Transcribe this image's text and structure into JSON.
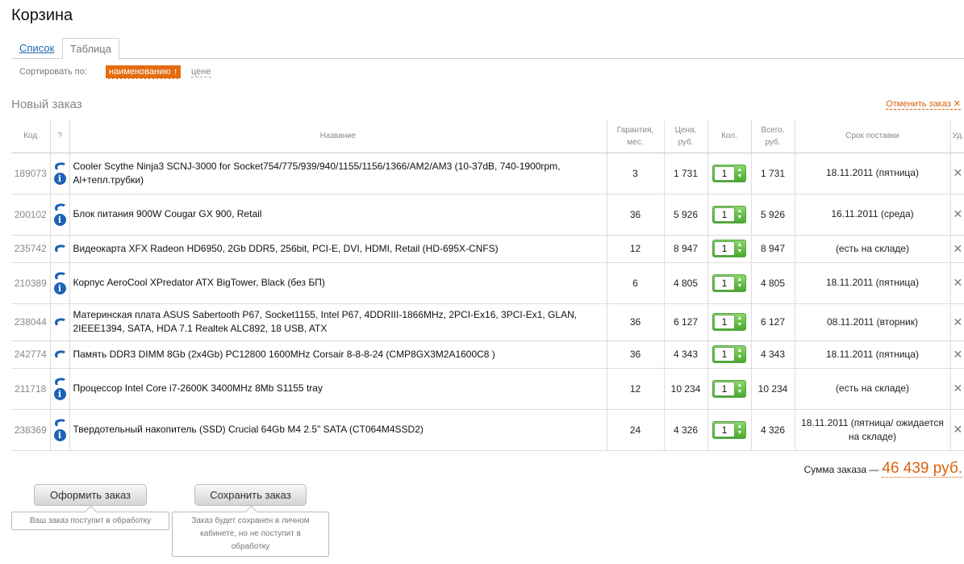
{
  "page": {
    "title": "Корзина"
  },
  "tabs": {
    "list": "Список",
    "table": "Таблица"
  },
  "sort": {
    "label": "Сортировать по:",
    "by_name": "наименованию ↑",
    "by_price": "цене"
  },
  "order": {
    "title": "Новый заказ",
    "cancel": "Отменить заказ"
  },
  "table": {
    "headers": {
      "code": "Код",
      "help": "?",
      "name": "Название",
      "warranty": [
        "Гарантия,",
        "мес."
      ],
      "price": [
        "Цена,",
        "руб."
      ],
      "qty": "Кол.",
      "total": [
        "Всего,",
        "руб."
      ],
      "term": "Срок поставки",
      "del": "Уд."
    },
    "rows": [
      {
        "code": "189073",
        "name": "Cooler Scythe Ninja3 SCNJ-3000 for Socket754/775/939/940/1155/1156/1366/AM2/AM3 (10-37dB, 740-1900rpm, Al+тепл.трубки)",
        "warranty": "3",
        "price": "1 731",
        "qty": "1",
        "total": "1 731",
        "term": "18.11.2011 (пятница)",
        "info": true,
        "height": 51
      },
      {
        "code": "200102",
        "name": "Блок питания 900W Cougar GX 900, Retail",
        "warranty": "36",
        "price": "5 926",
        "qty": "1",
        "total": "5 926",
        "term": "16.11.2011 (среда)",
        "info": true,
        "height": 51
      },
      {
        "code": "235742",
        "name": "Видеокарта XFX Radeon HD6950, 2Gb DDR5, 256bit, PCI-E, DVI, HDMI, Retail (HD-695X-CNFS)",
        "warranty": "12",
        "price": "8 947",
        "qty": "1",
        "total": "8 947",
        "term": "(есть на складе)",
        "info": false,
        "height": 34
      },
      {
        "code": "210389",
        "name": "Корпус AeroCool XPredator ATX BigTower, Black (без БП)",
        "warranty": "6",
        "price": "4 805",
        "qty": "1",
        "total": "4 805",
        "term": "18.11.2011 (пятница)",
        "info": true,
        "height": 51
      },
      {
        "code": "238044",
        "name": "Материнская плата ASUS Sabertooth P67, Socket1155, Intel P67, 4DDRIII-1866MHz, 2PCI-Ex16, 3PCI-Ex1, GLAN, 2IEEE1394, SATA, HDA 7.1 Realtek ALC892, 18 USB, ATX",
        "warranty": "36",
        "price": "6 127",
        "qty": "1",
        "total": "6 127",
        "term": "08.11.2011 (вторник)",
        "info": false,
        "height": 46
      },
      {
        "code": "242774",
        "name": "Память DDR3 DIMM 8Gb (2x4Gb) PC12800 1600MHz Corsair 8-8-8-24 (CMP8GX3M2A1600C8 )",
        "warranty": "36",
        "price": "4 343",
        "qty": "1",
        "total": "4 343",
        "term": "18.11.2011 (пятница)",
        "info": false,
        "height": 34
      },
      {
        "code": "211718",
        "name": "Процессор Intel Core i7-2600K 3400MHz 8Mb S1155 tray",
        "warranty": "12",
        "price": "10 234",
        "qty": "1",
        "total": "10 234",
        "term": "(есть на складе)",
        "info": true,
        "height": 51
      },
      {
        "code": "238369",
        "name": "Твердотельный накопитель (SSD) Crucial 64Gb M4 2.5\" SATA (CT064M4SSD2)",
        "warranty": "24",
        "price": "4 326",
        "qty": "1",
        "total": "4 326",
        "term": "18.11.2011 (пятница/ ожидается на складе)",
        "info": true,
        "height": 51
      }
    ]
  },
  "summary": {
    "label": "Сумма заказа —",
    "value": "46 439 руб."
  },
  "buttons": {
    "checkout": "Оформить заказ",
    "save": "Сохранить заказ",
    "checkout_note": "Ваш заказ поступит в обработку",
    "save_note": "Заказ будет сохранен в личном кабинете, но не поступит в обработку"
  },
  "colors": {
    "accent": "#e46c10",
    "link": "#1d6ab3",
    "qty_green": "#4aa82f",
    "info_blue": "#1b63b5"
  }
}
